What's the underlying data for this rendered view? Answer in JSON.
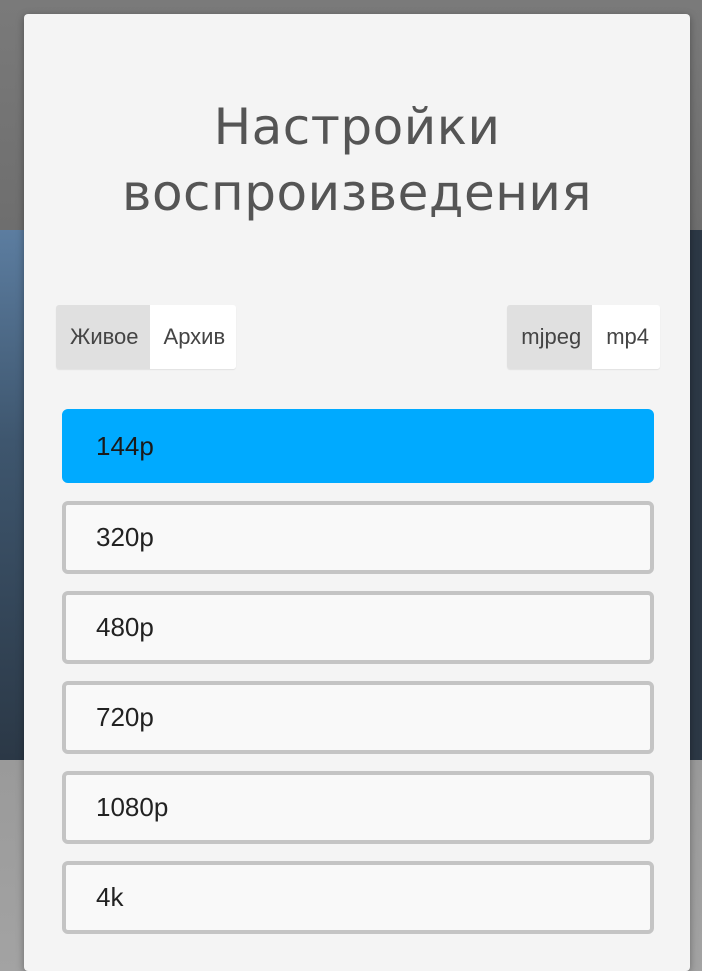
{
  "dialog": {
    "title_line1": "Настройки",
    "title_line2": "воспроизведения"
  },
  "mode_toggle": {
    "options": [
      "Живое",
      "Архив"
    ],
    "selected": "Архив"
  },
  "format_toggle": {
    "options": [
      "mjpeg",
      "mp4"
    ],
    "selected": "mp4"
  },
  "resolutions": {
    "options": [
      "144p",
      "320p",
      "480p",
      "720p",
      "1080p",
      "4k"
    ],
    "selected": "144p"
  },
  "colors": {
    "accent": "#00aaff",
    "dialog_background": "#f4f4f4",
    "segment_inactive": "#e0e0e0",
    "segment_active": "#ffffff",
    "button_border": "#c4c4c4",
    "title_text": "#555555"
  }
}
